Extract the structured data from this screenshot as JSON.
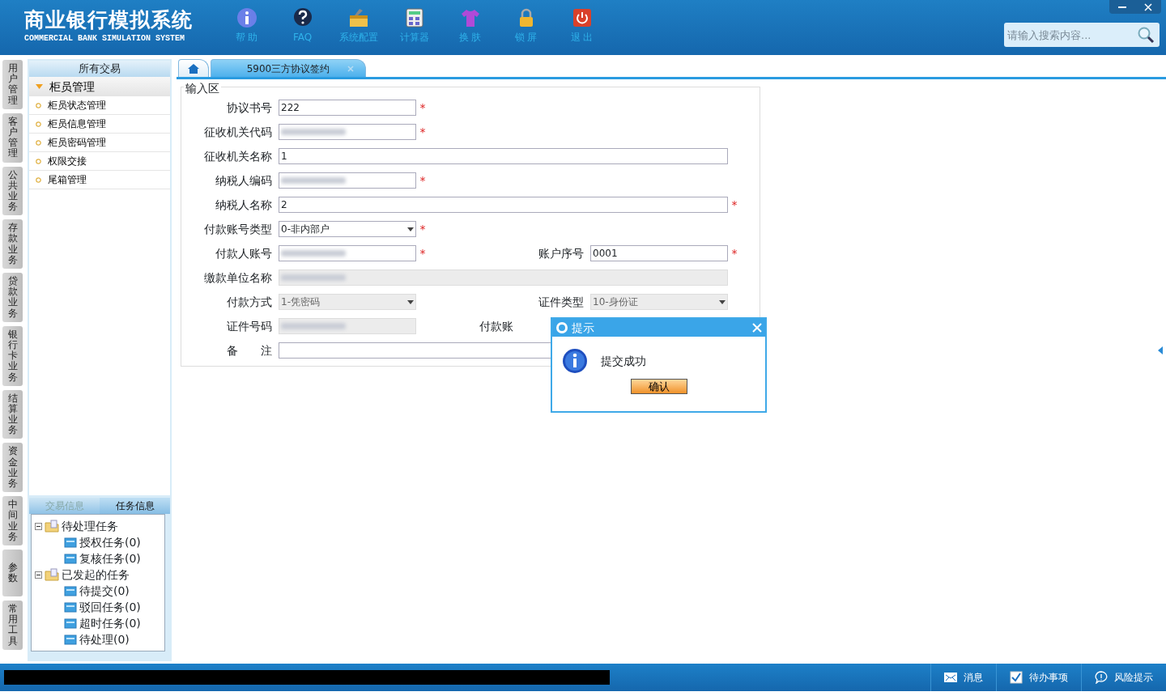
{
  "app": {
    "title": "商业银行模拟系统",
    "subtitle": "COMMERCIAL BANK SIMULATION SYSTEM"
  },
  "toolbar": [
    {
      "label": "帮 助",
      "kind": "info"
    },
    {
      "label": "FAQ",
      "kind": "faq"
    },
    {
      "label": "系统配置",
      "kind": "toolbox"
    },
    {
      "label": "计算器",
      "kind": "calc"
    },
    {
      "label": "换 肤",
      "kind": "shirt"
    },
    {
      "label": "锁 屏",
      "kind": "lock"
    },
    {
      "label": "退 出",
      "kind": "power"
    }
  ],
  "search": {
    "placeholder": "请输入搜索内容..."
  },
  "side_tabs": [
    "用户管理",
    "客户管理",
    "公共业务",
    "存款业务",
    "贷款业务",
    "银行卡业务",
    "结算业务",
    "资金业务",
    "中间业务",
    "参数",
    "常用工具"
  ],
  "sidebar": {
    "header": "所有交易",
    "group": {
      "label": "柜员管理",
      "expanded": true
    },
    "items": [
      "柜员状态管理",
      "柜员信息管理",
      "柜员密码管理",
      "权限交接",
      "尾箱管理"
    ]
  },
  "bottom_tabs": [
    {
      "label": "交易信息",
      "selected": false
    },
    {
      "label": "任务信息",
      "selected": true
    }
  ],
  "tree": [
    {
      "label": "待处理任务",
      "expanded": true,
      "children": [
        {
          "label": "授权任务(0)"
        },
        {
          "label": "复核任务(0)"
        }
      ]
    },
    {
      "label": "已发起的任务",
      "expanded": true,
      "children": [
        {
          "label": "待提交(0)"
        },
        {
          "label": "驳回任务(0)"
        },
        {
          "label": "超时任务(0)"
        },
        {
          "label": "待处理(0)"
        }
      ]
    }
  ],
  "tabs": [
    {
      "kind": "home",
      "selected": false
    },
    {
      "kind": "page",
      "label": "5900三方协议签约",
      "selected": true
    }
  ],
  "form": {
    "legend": "输入区",
    "rows": [
      [
        {
          "label": "协议书号",
          "value": "222",
          "kind": "input",
          "required_mark": "*"
        }
      ],
      [
        {
          "label": "征收机关代码",
          "kind": "input",
          "required_mark": "*",
          "blurred": true
        }
      ],
      [
        {
          "label": "征收机关名称",
          "value": "1",
          "kind": "input",
          "wide": true
        }
      ],
      [
        {
          "label": "纳税人编码",
          "kind": "input",
          "required_mark": "*",
          "blurred": true
        }
      ],
      [
        {
          "label": "纳税人名称",
          "value": "2",
          "kind": "input",
          "wide": true,
          "required_mark": "*"
        }
      ],
      [
        {
          "label": "付款账号类型",
          "value": "0-非内部户",
          "kind": "select",
          "required_mark": "*"
        }
      ],
      [
        {
          "label": "付款人账号",
          "kind": "input",
          "required_mark": "*",
          "blurred": true
        },
        {
          "label": "账户序号",
          "value": "0001",
          "kind": "input",
          "required_mark": "*"
        }
      ],
      [
        {
          "label": "缴款单位名称",
          "kind": "input",
          "wide": true,
          "readonly": true,
          "blurred": true
        }
      ],
      [
        {
          "label": "付款方式",
          "value": "1-凭密码",
          "kind": "select",
          "readonly": true
        },
        {
          "label": "证件类型",
          "value": "10-身份证",
          "kind": "select",
          "readonly": true
        }
      ],
      [
        {
          "label": "证件号码",
          "kind": "input",
          "readonly": true,
          "blurred": true
        },
        {
          "label": "付款账",
          "kind": "label"
        }
      ],
      [
        {
          "label": "备　　注",
          "kind": "input",
          "wide": true
        }
      ]
    ]
  },
  "dialog": {
    "title": "提示",
    "message": "提交成功",
    "button": "确认"
  },
  "status_bar": [
    {
      "label": "消息",
      "kind": "mail"
    },
    {
      "label": "待办事项",
      "kind": "check"
    },
    {
      "label": "风险提示",
      "kind": "bubble"
    }
  ]
}
